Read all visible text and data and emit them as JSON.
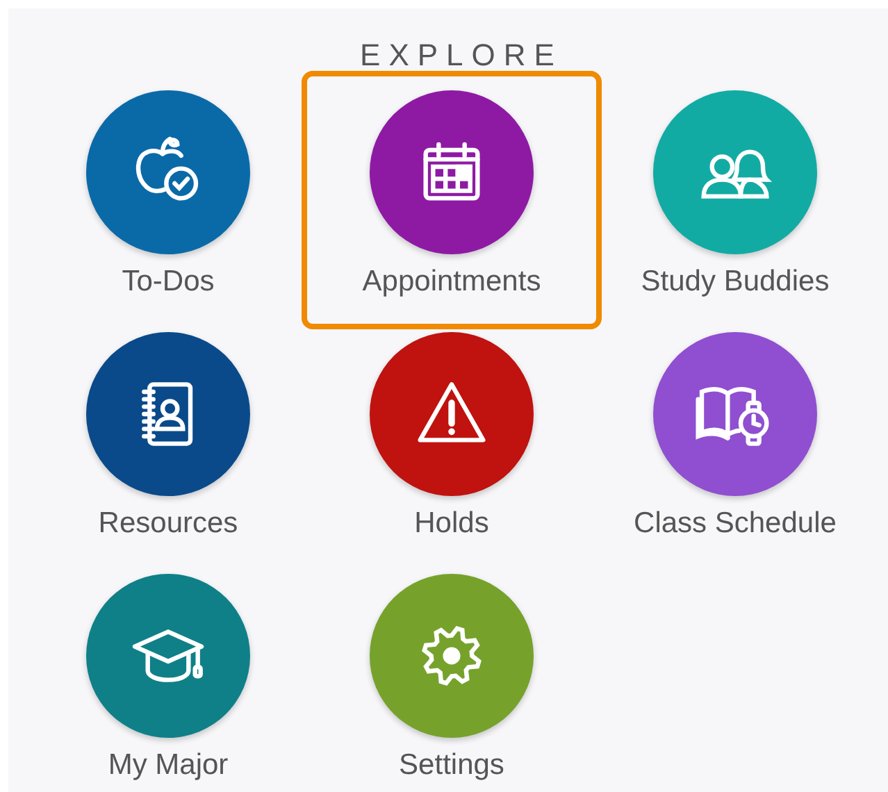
{
  "heading": "EXPLORE",
  "items": [
    {
      "label": "To-Dos",
      "kind": "apple",
      "color": "#0a6aa8",
      "highlighted": false
    },
    {
      "label": "Appointments",
      "kind": "calendar",
      "color": "#8e1aa4",
      "highlighted": true
    },
    {
      "label": "Study Buddies",
      "kind": "people",
      "color": "#12aba3",
      "highlighted": false
    },
    {
      "label": "Resources",
      "kind": "addressbook",
      "color": "#0a4a8a",
      "highlighted": false
    },
    {
      "label": "Holds",
      "kind": "warning",
      "color": "#c0120e",
      "highlighted": false
    },
    {
      "label": "Class Schedule",
      "kind": "schedule",
      "color": "#8f4fd0",
      "highlighted": false
    },
    {
      "label": "My Major",
      "kind": "cap",
      "color": "#0f8088",
      "highlighted": false
    },
    {
      "label": "Settings",
      "kind": "gear",
      "color": "#76a22c",
      "highlighted": false
    }
  ]
}
